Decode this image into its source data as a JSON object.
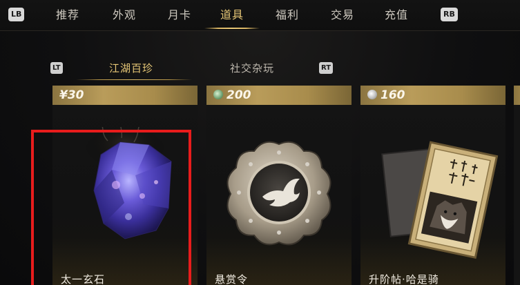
{
  "nav": {
    "left_button": "LB",
    "right_button": "RB",
    "tabs": [
      {
        "label": "推荐"
      },
      {
        "label": "外观"
      },
      {
        "label": "月卡"
      },
      {
        "label": "道具"
      },
      {
        "label": "福利"
      },
      {
        "label": "交易"
      },
      {
        "label": "充值"
      }
    ],
    "active_tab": "道具"
  },
  "subnav": {
    "left_button": "LT",
    "right_button": "RT",
    "tabs": [
      {
        "label": "江湖百珍"
      },
      {
        "label": "社交杂玩"
      }
    ],
    "active_tab": "江湖百珍"
  },
  "items": [
    {
      "name": "太一玄石",
      "price": "¥30",
      "currency_icon": "none",
      "selected": true
    },
    {
      "name": "悬赏令",
      "price": "200",
      "currency_icon": "jade-coin-icon",
      "selected": false
    },
    {
      "name": "升阶帖·哈是骑",
      "price": "160",
      "currency_icon": "silver-coin-icon",
      "selected": false
    }
  ],
  "colors": {
    "accent_gold": "#e8c877",
    "selection_red": "#e81c1c",
    "price_bar": "#b99c5a"
  }
}
